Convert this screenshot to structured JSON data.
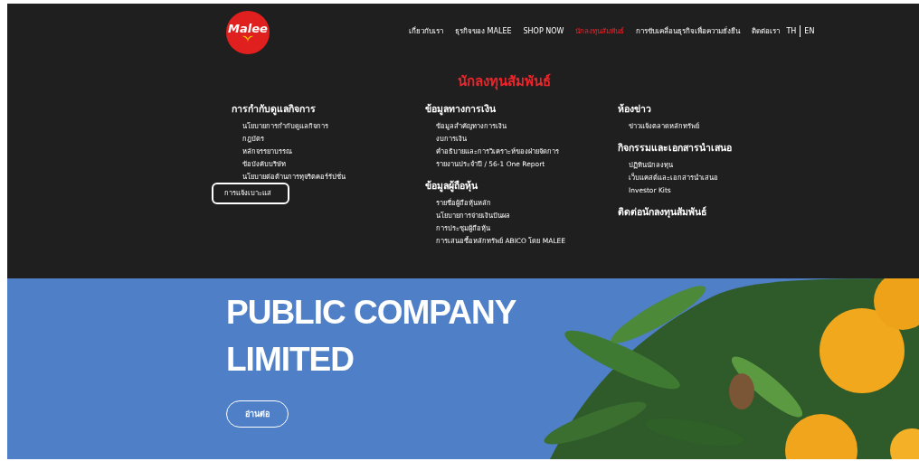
{
  "logo": {
    "text": "Malee"
  },
  "nav": [
    {
      "label": "เกี่ยวกับเรา",
      "selected": false
    },
    {
      "label": "ธุรกิจของ MALEE",
      "selected": false
    },
    {
      "label": "SHOP NOW",
      "selected": false
    },
    {
      "label": "นักลงทุนสัมพันธ์",
      "selected": true
    },
    {
      "label": "การขับเคลื่อนธุรกิจเพื่อความยั่งยืน",
      "selected": false
    },
    {
      "label": "ติดต่อเรา",
      "selected": false
    }
  ],
  "languages": [
    {
      "label": "TH"
    },
    {
      "label": "EN"
    }
  ],
  "menu": {
    "title": "นักลงทุนสัมพันธ์",
    "columns": [
      [
        {
          "heading": "การกำกับดูแลกิจการ",
          "items": [
            {
              "label": "นโยบายการกำกับดูแลกิจการ",
              "highlighted": false
            },
            {
              "label": "กฎบัตร",
              "highlighted": false
            },
            {
              "label": "หลักจรรยาบรรณ",
              "highlighted": false
            },
            {
              "label": "ข้อบังคับบริษัท",
              "highlighted": false
            },
            {
              "label": "นโยบายต่อต้านการทุจริตคอร์รัปชั่น",
              "highlighted": false
            },
            {
              "label": "การแจ้งเบาะแส",
              "highlighted": true
            }
          ]
        }
      ],
      [
        {
          "heading": "ข้อมูลทางการเงิน",
          "items": [
            {
              "label": "ข้อมูลสำคัญทางการเงิน",
              "highlighted": false
            },
            {
              "label": "งบการเงิน",
              "highlighted": false
            },
            {
              "label": "คำอธิบายและการวิเคราะห์ของฝ่ายจัดการ",
              "highlighted": false
            },
            {
              "label": "รายงานประจำปี / 56-1 One Report",
              "highlighted": false
            }
          ]
        },
        {
          "heading": "ข้อมูลผู้ถือหุ้น",
          "items": [
            {
              "label": "รายชื่อผู้ถือหุ้นหลัก",
              "highlighted": false
            },
            {
              "label": "นโยบายการจ่ายเงินปันผล",
              "highlighted": false
            },
            {
              "label": "การประชุมผู้ถือหุ้น",
              "highlighted": false
            },
            {
              "label": "การเสนอซื้อหลักทรัพย์ ABICO โดย MALEE",
              "highlighted": false
            }
          ]
        }
      ],
      [
        {
          "heading": "ห้องข่าว",
          "items": [
            {
              "label": "ข่าวแจ้งตลาดหลักทรัพย์",
              "highlighted": false
            }
          ]
        },
        {
          "heading": "กิจกรรมและเอกสารนำเสนอ",
          "items": [
            {
              "label": "ปฏิทินนักลงทุน",
              "highlighted": false
            },
            {
              "label": "เว็บแคสต์และเอกสารนำเสนอ",
              "highlighted": false
            },
            {
              "label": "Investor Kits",
              "highlighted": false
            }
          ]
        },
        {
          "heading": "ติดต่อนักลงทุนสัมพันธ์"
        }
      ]
    ]
  },
  "hero": {
    "title_lines": [
      "PUBLIC COMPANY",
      "LIMITED"
    ],
    "button": "อ่านต่อ",
    "background": {
      "kind": "picture"
    }
  }
}
